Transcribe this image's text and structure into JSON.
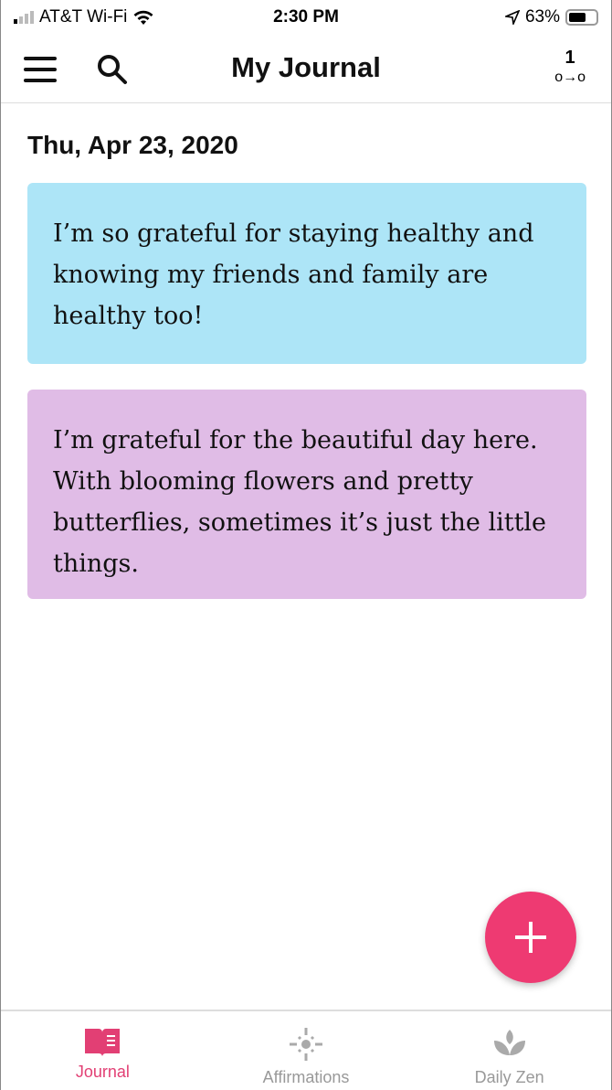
{
  "status": {
    "carrier": "AT&T Wi-Fi",
    "time": "2:30 PM",
    "battery": "63%",
    "battery_level": 63
  },
  "header": {
    "title": "My Journal",
    "sync_count": "1",
    "sync_symbol": "o→o"
  },
  "date": "Thu, Apr 23, 2020",
  "entries": [
    {
      "text": "I’m so grateful for staying healthy and knowing my friends and family are healthy too!",
      "color": "#ade5f7"
    },
    {
      "text": "I’m grateful for the beautiful day here. With blooming flowers and pretty butterflies, sometimes it’s just the little things.",
      "color": "#e0bce6"
    }
  ],
  "fab": {
    "icon": "plus-icon",
    "color": "#ee3a72"
  },
  "nav": [
    {
      "label": "Journal",
      "icon": "book-icon",
      "active": true
    },
    {
      "label": "Affirmations",
      "icon": "sun-icon"
    },
    {
      "label": "Daily Zen",
      "icon": "lotus-icon"
    }
  ],
  "accent": "#e23f74"
}
